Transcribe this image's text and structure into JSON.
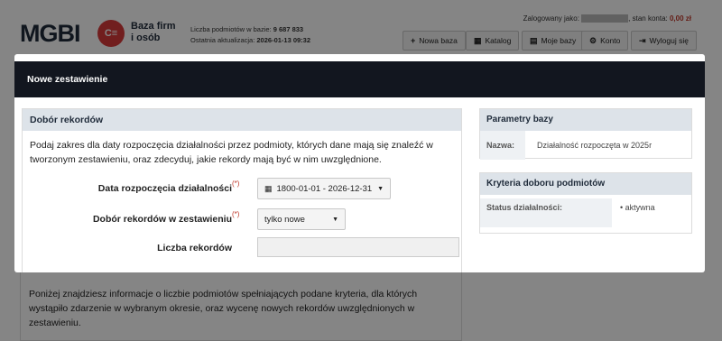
{
  "header": {
    "logo": "MGBI",
    "logo_badge": "C≡",
    "logo_sub_1": "Baza firm",
    "logo_sub_2": "i osób",
    "db_count_label": "Liczba podmiotów w bazie:",
    "db_count_value": "9 687 833",
    "update_label": "Ostatnia aktualizacja:",
    "update_value": "2026-01-13 09:32",
    "logged_label": "Zalogowany jako:",
    "balance_label": ", stan konta:",
    "balance_value": "0,00 zł",
    "buttons": [
      {
        "label": "Nowa baza",
        "icon": "+"
      },
      {
        "label": "Katalog",
        "icon": "▦"
      },
      {
        "label": "Moje bazy",
        "icon": "▤"
      },
      {
        "label": "Konto",
        "icon": "⚙"
      },
      {
        "label": "Wyloguj się",
        "icon": "⇥"
      }
    ]
  },
  "background": {
    "info_text": "Poniżej znajdziesz informacje o liczbie podmiotów spełniających podane kryteria, dla których wystąpiło zdarzenie w wybranym okresie, oraz wycenę nowych rekordów uwzględnionych w zestawieniu."
  },
  "modal": {
    "title": "Nowe zestawienie",
    "left": {
      "title": "Dobór rekordów",
      "description": "Podaj zakres dla daty rozpoczęcia działalności przez podmioty, których dane mają się znaleźć w tworzonym zestawieniu, oraz zdecyduj, jakie rekordy mają być w nim uwzględnione.",
      "required_mark": "(*)",
      "date_label": "Data rozpoczęcia działalności",
      "date_value": "1800-01-01 - 2026-12-31",
      "selection_label": "Dobór rekordów w zestawieniu",
      "selection_value": "tylko nowe",
      "count_label": "Liczba rekordów",
      "count_value": ""
    },
    "params": {
      "title": "Parametry bazy",
      "name_key": "Nazwa:",
      "name_value": "Działalność rozpoczęta w 2025r"
    },
    "criteria": {
      "title": "Kryteria doboru podmiotów",
      "status_key": "Status działalności:",
      "status_value": "aktywna"
    }
  }
}
